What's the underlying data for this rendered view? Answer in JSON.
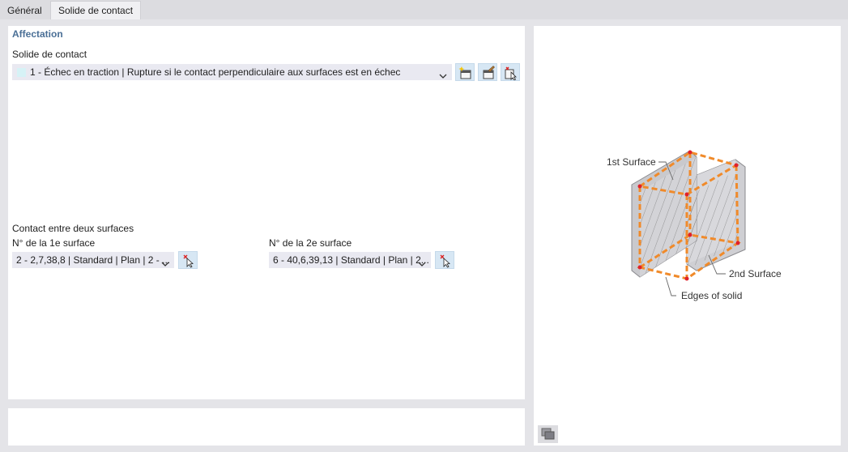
{
  "tabs": [
    "Général",
    "Solide de contact"
  ],
  "section": {
    "title": "Affectation",
    "solid_label": "Solide de contact",
    "solid_value": "1 - Échec en traction | Rupture si le contact perpendiculaire aux surfaces est en échec",
    "contact_label": "Contact entre deux surfaces",
    "surface1_label": "N° de la 1e surface",
    "surface1_value": "2 - 2,7,38,8 | Standard | Plan | 2 - ...",
    "surface2_label": "N° de la 2e surface",
    "surface2_value": "6 - 40,6,39,13 | Standard | Plan | 2..."
  },
  "diagram": {
    "label_1st": "1st Surface",
    "label_2nd": "2nd Surface",
    "label_edges": "Edges of solid"
  },
  "colors": {
    "accent": "#4a6f96",
    "edge": "#f08a2a",
    "corner": "#e0202a"
  },
  "icons": [
    "new-icon",
    "edit-icon",
    "pick-icon",
    "pick-surface-icon",
    "chevron-down-icon",
    "view-options-icon"
  ]
}
